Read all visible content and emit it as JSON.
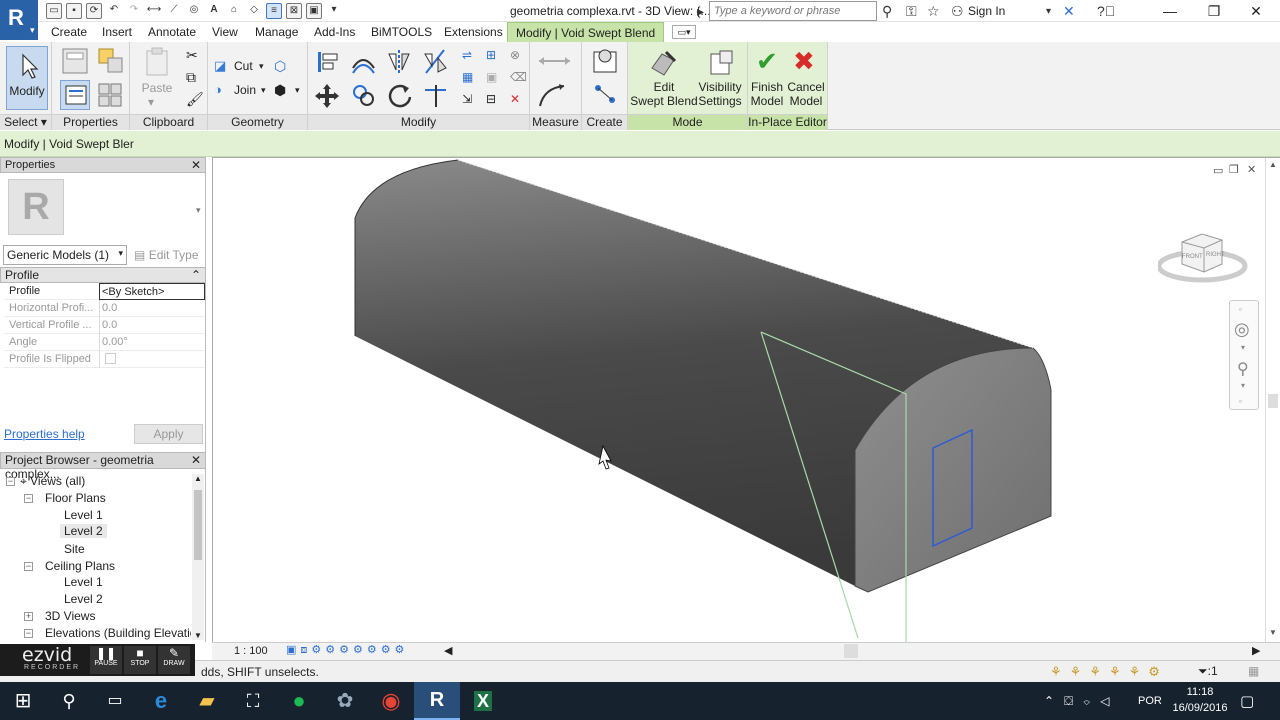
{
  "title_bar": {
    "app_letter": "R",
    "document_title": "geometria complexa.rvt - 3D View: {...",
    "search_placeholder": "Type a keyword or phrase",
    "sign_in": "Sign In"
  },
  "tabs": [
    "Create",
    "Insert",
    "Annotate",
    "View",
    "Manage",
    "Add-Ins",
    "BiMTOOLS",
    "Extensions",
    "Modify | Void Swept Blend"
  ],
  "ribbon": {
    "modify_label": "Modify",
    "select_label": "Select",
    "properties_label": "Properties",
    "clipboard_label": "Clipboard",
    "paste_label": "Paste",
    "cut_label": "Cut",
    "join_label": "Join",
    "geometry_label": "Geometry",
    "modify_panel_label": "Modify",
    "measure_label": "Measure",
    "create_label": "Create",
    "mode_label": "Mode",
    "edit_swept_blend": "Edit\nSwept Blend",
    "edit_line1": "Edit",
    "edit_line2": "Swept Blend",
    "visibility_line1": "Visibility",
    "visibility_line2": "Settings",
    "finish_line1": "Finish",
    "finish_line2": "Model",
    "cancel_line1": "Cancel",
    "cancel_line2": "Model",
    "inplace_label": "In-Place Editor",
    "colors": {
      "active_tab": "#c7e3a8",
      "panel_green": "#e2f1d3",
      "finish": "#2f9e2f",
      "cancel": "#d62c2c"
    }
  },
  "option_bar": {
    "context": "Modify | Void Swept Bler"
  },
  "properties": {
    "header": "Properties",
    "type_selector": "Generic Models (1)",
    "edit_type": "Edit Type",
    "group": "Profile",
    "rows": [
      {
        "key": "Profile",
        "value": "<By Sketch>"
      },
      {
        "key": "Horizontal Profi...",
        "value": "0.0"
      },
      {
        "key": "Vertical Profile ...",
        "value": "0.0"
      },
      {
        "key": "Angle",
        "value": "0.00°"
      },
      {
        "key": "Profile Is Flipped",
        "value": ""
      }
    ],
    "help_link": "Properties help",
    "apply": "Apply"
  },
  "project_browser": {
    "header": "Project Browser - geometria complex...",
    "items": [
      {
        "label": "Views (all)",
        "level": 0
      },
      {
        "label": "Floor Plans",
        "level": 1
      },
      {
        "label": "Level 1",
        "level": 2
      },
      {
        "label": "Level 2",
        "level": 2
      },
      {
        "label": "Site",
        "level": 2
      },
      {
        "label": "Ceiling Plans",
        "level": 1
      },
      {
        "label": "Level 1",
        "level": 2
      },
      {
        "label": "Level 2",
        "level": 2
      },
      {
        "label": "3D Views",
        "level": 1
      },
      {
        "label": "Elevations (Building Elevation",
        "level": 1
      }
    ]
  },
  "view": {
    "scale": "1 : 100",
    "viewcube_front": "FRONT",
    "viewcube_right": "RIGHT"
  },
  "status": {
    "text": "dds, SHIFT unselects.",
    "filter_count": ":1"
  },
  "ezvid": {
    "logo": "ezvid",
    "sub": "RECORDER",
    "pause": "PAUSE",
    "stop": "STOP",
    "draw": "DRAW"
  },
  "taskbar": {
    "time": "11:18",
    "date": "16/09/2016",
    "lang": "POR"
  }
}
